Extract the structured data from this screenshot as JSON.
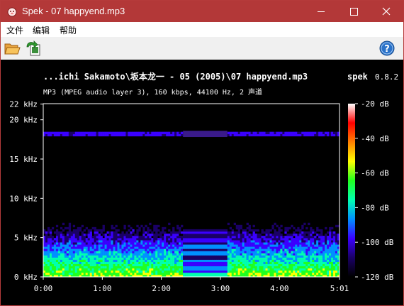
{
  "window": {
    "title": "Spek - 07 happyend.mp3"
  },
  "menu": {
    "items": [
      "文件",
      "编辑",
      "帮助"
    ]
  },
  "icons": {
    "app": "spek-app-icon",
    "open": "open-folder-icon",
    "save": "save-image-icon",
    "help": "help-icon",
    "minimize": "minimize-icon",
    "maximize": "maximize-icon",
    "close": "close-icon"
  },
  "colors": {
    "titlebar": "#b33838",
    "background": "#000000",
    "text": "#ffffff"
  },
  "spectrum": {
    "header_title": "...ichi Sakamoto\\坂本龙一 - 05 (2005)\\07 happyend.mp3",
    "app_label": "spek",
    "version": "0.8.2",
    "subtitle": "MP3 (MPEG audio layer 3), 160 kbps, 44100 Hz, 2 声道"
  },
  "chart_data": {
    "type": "heatmap",
    "x_ticks": [
      "0:00",
      "1:00",
      "2:00",
      "3:00",
      "4:00",
      "5:01"
    ],
    "x_tick_seconds": [
      0,
      60,
      120,
      180,
      240,
      301
    ],
    "xlim_seconds": [
      0,
      301
    ],
    "y_ticks": [
      "0 kHz",
      "5 kHz",
      "10 kHz",
      "15 kHz",
      "20 kHz",
      "22 kHz"
    ],
    "y_tick_khz": [
      0,
      5,
      10,
      15,
      20,
      22
    ],
    "ylim_khz": [
      0,
      22.05
    ],
    "colorbar_ticks": [
      "-20 dB",
      "-40 dB",
      "-60 dB",
      "-80 dB",
      "-100 dB",
      "-120 dB"
    ],
    "colorbar_db": [
      -20,
      -40,
      -60,
      -80,
      -100,
      -120
    ],
    "colorbar_range_db": [
      -120,
      -20
    ],
    "colorbar_stops": [
      "#000000",
      "#1a0066",
      "#3a00ff",
      "#0090ff",
      "#00ffb0",
      "#20ff20",
      "#ffff00",
      "#ff8000",
      "#ff0000",
      "#ffffff"
    ],
    "quiet_section_seconds": [
      142,
      187
    ],
    "lowpass_band_khz": [
      17.8,
      18.6
    ]
  }
}
